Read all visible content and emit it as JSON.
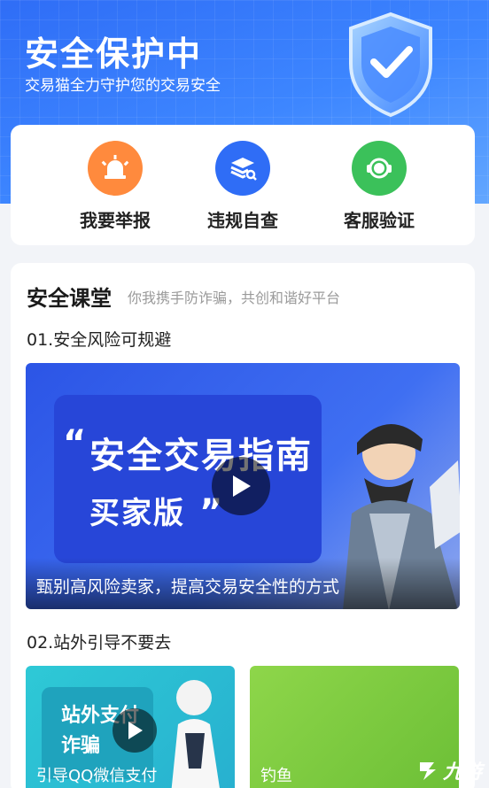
{
  "hero": {
    "title": "安全保护中",
    "subtitle": "交易猫全力守护您的交易安全"
  },
  "quick_actions": [
    {
      "label": "我要举报",
      "icon": "alarm-icon",
      "color": "#ff8a3d"
    },
    {
      "label": "违规自查",
      "icon": "layers-search-icon",
      "color": "#2f6df6"
    },
    {
      "label": "客服验证",
      "icon": "support-icon",
      "color": "#3bc15a"
    }
  ],
  "course": {
    "title": "安全课堂",
    "subtitle": "你我携手防诈骗，共创和谐好平台",
    "lessons": [
      {
        "title": "01.安全风险可规避",
        "videos": [
          {
            "headline": "安全交易指南",
            "subheadline": "买家版",
            "caption": "甄别高风险卖家，提高交易安全性的方式"
          }
        ]
      },
      {
        "title": "02.站外引导不要去",
        "videos": [
          {
            "headline": "站外支付",
            "subheadline": "诈骗",
            "caption": "引导QQ微信支付"
          },
          {
            "caption": "钓鱼"
          }
        ]
      }
    ]
  },
  "watermark": {
    "text": "九游"
  },
  "colors": {
    "primary": "#2f6df6",
    "card": "#ffffff",
    "background": "#f2f4f8"
  }
}
